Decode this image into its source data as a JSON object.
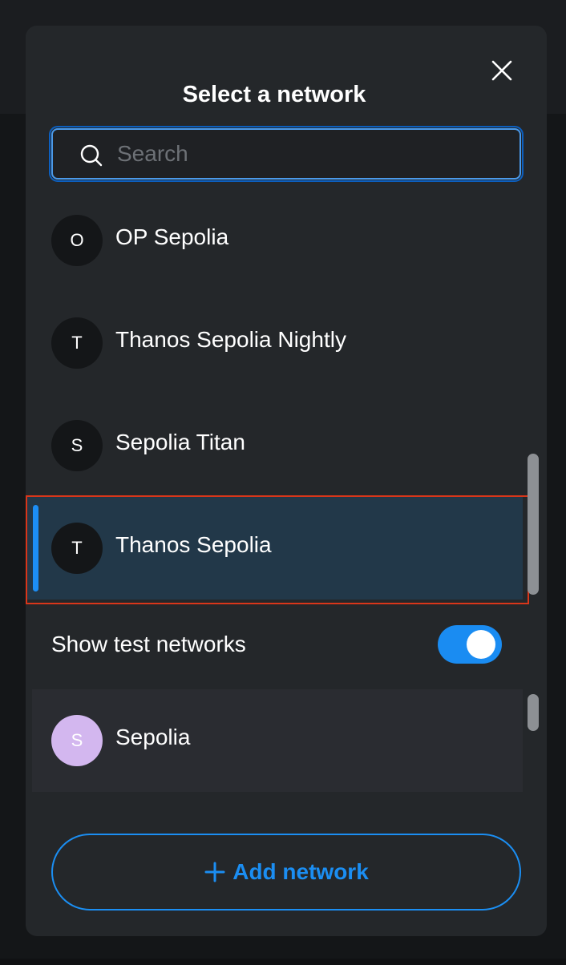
{
  "modal": {
    "title": "Select a network",
    "close_icon": "close-icon"
  },
  "search": {
    "placeholder": "Search",
    "value": "",
    "icon": "search-icon"
  },
  "networks": [
    {
      "initial": "O",
      "label": "OP Sepolia",
      "selected": false
    },
    {
      "initial": "T",
      "label": "Thanos Sepolia Nightly",
      "selected": false
    },
    {
      "initial": "S",
      "label": "Sepolia Titan",
      "selected": false
    },
    {
      "initial": "T",
      "label": "Thanos Sepolia",
      "selected": true
    }
  ],
  "test_networks_toggle": {
    "label": "Show test networks",
    "enabled": true
  },
  "test_networks": [
    {
      "initial": "S",
      "label": "Sepolia",
      "avatar_color": "#d3b7ef"
    }
  ],
  "add_network": {
    "label": "Add network",
    "icon": "plus-icon"
  },
  "colors": {
    "accent": "#1a8cf2",
    "selected_row_bg": "#223849",
    "highlight_border": "#d9361a",
    "modal_bg": "#24272a"
  }
}
